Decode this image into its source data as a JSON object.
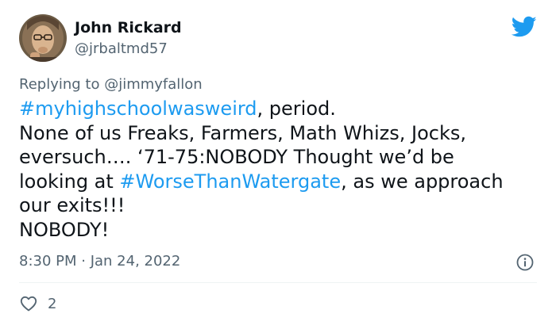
{
  "author": {
    "name": "John Rickard",
    "handle": "@jrbaltmd57"
  },
  "reply": {
    "prefix": "Replying to ",
    "mention": "@jimmyfallon"
  },
  "body": {
    "hashtag1": "#myhighschoolwasweird",
    "line1_rest": ", period.",
    "line2": "None of us Freaks, Farmers, Math Whizs, Jocks,",
    "line3": "eversuch…. ‘71-75:NOBODY Thought we’d be",
    "line4_pre": "looking at ",
    "hashtag2": "#WorseThanWatergate",
    "line4_post": ", as we approach",
    "line5": "our exits!!!",
    "line6": "NOBODY!"
  },
  "meta": {
    "time": "8:30 PM",
    "separator": " · ",
    "date": "Jan 24, 2022"
  },
  "actions": {
    "like_count": "2"
  },
  "colors": {
    "link": "#1d9bf0",
    "twitter_blue": "#1d9bf0",
    "secondary_text": "#536471",
    "primary_text": "#0f1419"
  },
  "icons": {
    "brand": "twitter-bird-icon",
    "info": "info-icon",
    "like": "heart-icon"
  }
}
